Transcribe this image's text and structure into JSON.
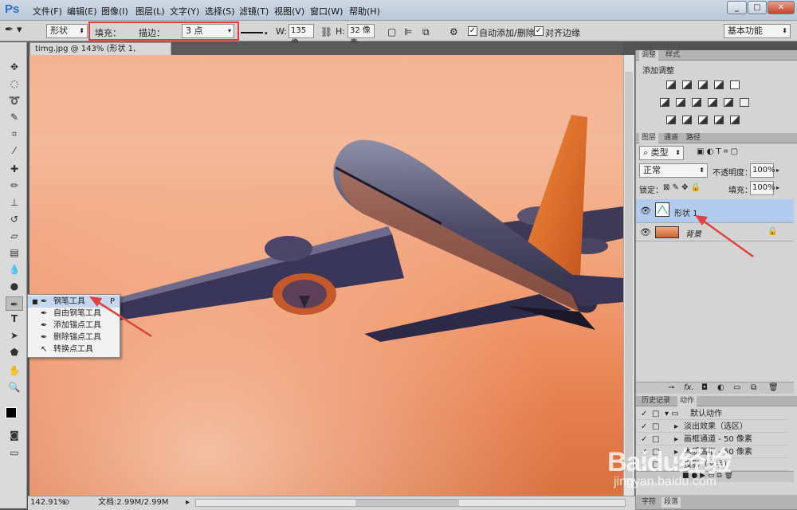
{
  "app": {
    "logo": "Ps"
  },
  "menu": [
    "文件(F)",
    "编辑(E)",
    "图像(I)",
    "图层(L)",
    "文字(Y)",
    "选择(S)",
    "滤镜(T)",
    "视图(V)",
    "窗口(W)",
    "帮助(H)"
  ],
  "options": {
    "mode": "形状",
    "fill_label": "填充：",
    "stroke_label": "描边：",
    "stroke_color": "#1ab3b8",
    "stroke_width": "3 点",
    "w_label": "W:",
    "w_value": "135 像",
    "h_label": "H:",
    "h_value": "32 像素",
    "auto_add_delete": "自动添加/删除",
    "align_edges": "对齐边缘",
    "workspace": "基本功能",
    "highlight_color": "#e03a3a"
  },
  "document": {
    "tab_title": "timg.jpg @ 143% (形状 1, RGB/8#) *",
    "zoom": "142.91%",
    "doc_size": "文档:2.99M/2.99M"
  },
  "tool_flyout": [
    {
      "label": "钢笔工具",
      "key": "P"
    },
    {
      "label": "自由钢笔工具",
      "key": ""
    },
    {
      "label": "添加锚点工具",
      "key": ""
    },
    {
      "label": "删除锚点工具",
      "key": ""
    },
    {
      "label": "转换点工具",
      "key": ""
    }
  ],
  "adjustments": {
    "tabs": [
      "调整",
      "样式"
    ],
    "title": "添加调整"
  },
  "layers": {
    "tabs": [
      "图层",
      "通道",
      "路径"
    ],
    "filter": "类型",
    "blend": "正常",
    "opacity_label": "不透明度：",
    "opacity": "100%",
    "lock_label": "锁定：",
    "fill_label": "填充：",
    "fill": "100%",
    "items": [
      {
        "name": "形状 1",
        "selected": true
      },
      {
        "name": "背景",
        "selected": false
      }
    ]
  },
  "history": {
    "tabs": [
      "历史记录",
      "动作"
    ],
    "rows": [
      "默认动作",
      "淡出效果（选区）",
      "画框通道 - 50 像素",
      "木质画框 - 50 像素",
      "投影（文字）"
    ]
  },
  "bottom_tabs": [
    "字符",
    "段落"
  ],
  "watermark": {
    "brand": "Baidu经验",
    "url": "jingyan.baidu.com"
  }
}
